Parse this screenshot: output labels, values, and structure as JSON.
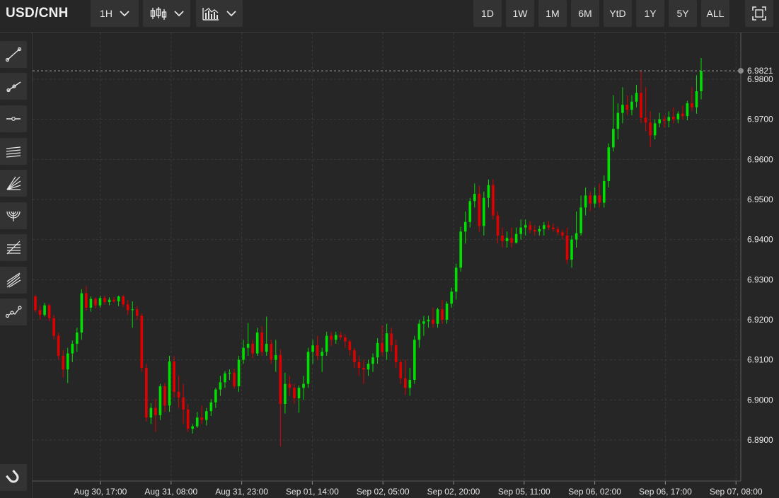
{
  "header": {
    "symbol": "USD/CNH",
    "interval_label": "1H",
    "chart_type_icon": "candlestick-icon",
    "indicators_icon": "indicators-icon",
    "ranges": [
      "1D",
      "1W",
      "1M",
      "6M",
      "YtD",
      "1Y",
      "5Y",
      "ALL"
    ],
    "fullscreen_icon": "fullscreen-icon"
  },
  "sidebar": {
    "tools": [
      "trend-line-icon",
      "ray-icon",
      "horizontal-line-icon",
      "parallel-channel-icon",
      "fib-fan-icon",
      "fib-arc-icon",
      "fib-retracement-icon",
      "pitchfork-icon",
      "path-icon"
    ],
    "bottom_tool": "magnet-icon"
  },
  "colors": {
    "up": "#00e000",
    "down": "#e00000",
    "grid": "#3a3a3a",
    "background": "#262626"
  },
  "chart_data": {
    "type": "candlestick",
    "interval": "1H",
    "ylim": [
      6.881,
      6.988
    ],
    "yticks": [
      "6.8900",
      "6.9000",
      "6.9100",
      "6.9200",
      "6.9300",
      "6.9400",
      "6.9500",
      "6.9600",
      "6.9700",
      "6.9800"
    ],
    "last_price": "6.9821",
    "x_tick_labels": [
      "Aug 30, 17:00",
      "Aug 31, 08:00",
      "Aug 31, 23:00",
      "Sep 01, 14:00",
      "Sep 02, 05:00",
      "Sep 02, 20:00",
      "Sep 05, 11:00",
      "Sep 06, 02:00",
      "Sep 06, 17:00",
      "Sep 07, 08:00"
    ],
    "grid": true,
    "candles": [
      [
        6.9258,
        6.9262,
        6.9218,
        6.9224
      ],
      [
        6.9224,
        6.9236,
        6.92,
        6.9212
      ],
      [
        6.9212,
        6.9242,
        6.9208,
        6.9236
      ],
      [
        6.9236,
        6.924,
        6.9196,
        6.9204
      ],
      [
        6.9204,
        6.9212,
        6.915,
        6.916
      ],
      [
        6.916,
        6.9168,
        6.91,
        6.911
      ],
      [
        6.911,
        6.9124,
        6.9056,
        6.9076
      ],
      [
        6.9076,
        6.913,
        6.9042,
        6.9116
      ],
      [
        6.9116,
        6.9148,
        6.9094,
        6.914
      ],
      [
        6.914,
        6.918,
        6.912,
        6.9168
      ],
      [
        6.9168,
        6.9276,
        6.915,
        6.9266
      ],
      [
        6.9266,
        6.9284,
        6.9222,
        6.923
      ],
      [
        6.923,
        6.9258,
        6.922,
        6.9252
      ],
      [
        6.9252,
        6.9256,
        6.9228,
        6.9236
      ],
      [
        6.9236,
        6.926,
        6.923,
        6.9254
      ],
      [
        6.9254,
        6.926,
        6.9238,
        6.9244
      ],
      [
        6.9244,
        6.9256,
        6.9236,
        6.925
      ],
      [
        6.925,
        6.9256,
        6.9242,
        6.9246
      ],
      [
        6.9246,
        6.926,
        6.9234,
        6.9258
      ],
      [
        6.9258,
        6.9262,
        6.9232,
        6.9238
      ],
      [
        6.9238,
        6.925,
        6.9212,
        6.9224
      ],
      [
        6.9224,
        6.9246,
        6.918,
        6.9226
      ],
      [
        6.9226,
        6.9234,
        6.92,
        6.921
      ],
      [
        6.921,
        6.9216,
        6.907,
        6.908
      ],
      [
        6.908,
        6.909,
        6.8946,
        6.8956
      ],
      [
        6.8956,
        6.8992,
        6.894,
        6.898
      ],
      [
        6.898,
        6.9002,
        6.892,
        6.8962
      ],
      [
        6.8962,
        6.904,
        6.895,
        6.9034
      ],
      [
        6.9034,
        6.9042,
        6.897,
        6.8986
      ],
      [
        6.8986,
        6.911,
        6.897,
        6.9096
      ],
      [
        6.9096,
        6.911,
        6.9006,
        6.902
      ],
      [
        6.902,
        6.906,
        6.898,
        6.9006
      ],
      [
        6.9006,
        6.904,
        6.894,
        6.8976
      ],
      [
        6.8976,
        6.899,
        6.892,
        6.8928
      ],
      [
        6.8928,
        6.894,
        6.8916,
        6.8934
      ],
      [
        6.8934,
        6.897,
        6.893,
        6.8956
      ],
      [
        6.8956,
        6.8986,
        6.894,
        6.895
      ],
      [
        6.895,
        6.898,
        6.8936,
        6.8972
      ],
      [
        6.8972,
        6.9002,
        6.896,
        6.8994
      ],
      [
        6.8994,
        6.903,
        6.898,
        6.9026
      ],
      [
        6.9026,
        6.906,
        6.901,
        6.9044
      ],
      [
        6.9044,
        6.9072,
        6.903,
        6.9066
      ],
      [
        6.9066,
        6.9076,
        6.905,
        6.9068
      ],
      [
        6.9068,
        6.9078,
        6.9028,
        6.9034
      ],
      [
        6.9034,
        6.911,
        6.902,
        6.91
      ],
      [
        6.91,
        6.915,
        6.909,
        6.913
      ],
      [
        6.913,
        6.9192,
        6.911,
        6.914
      ],
      [
        6.914,
        6.915,
        6.9104,
        6.9116
      ],
      [
        6.9116,
        6.918,
        6.911,
        6.9168
      ],
      [
        6.9168,
        6.9184,
        6.911,
        6.912
      ],
      [
        6.912,
        6.9208,
        6.911,
        6.914
      ],
      [
        6.914,
        6.915,
        6.909,
        6.91
      ],
      [
        6.91,
        6.915,
        6.907,
        6.9112
      ],
      [
        6.9112,
        6.9126,
        6.8884,
        6.899
      ],
      [
        6.899,
        6.9068,
        6.8966,
        6.904
      ],
      [
        6.904,
        6.906,
        6.901,
        6.903
      ],
      [
        6.903,
        6.904,
        6.899,
        6.9004
      ],
      [
        6.9004,
        6.9036,
        6.8968,
        6.903
      ],
      [
        6.903,
        6.906,
        6.9,
        6.904
      ],
      [
        6.904,
        6.913,
        6.903,
        6.912
      ],
      [
        6.912,
        6.915,
        6.909,
        6.9136
      ],
      [
        6.9136,
        6.916,
        6.91,
        6.911
      ],
      [
        6.911,
        6.913,
        6.907,
        6.912
      ],
      [
        6.912,
        6.917,
        6.911,
        6.916
      ],
      [
        6.916,
        6.917,
        6.9134,
        6.915
      ],
      [
        6.915,
        6.917,
        6.914,
        6.9162
      ],
      [
        6.9162,
        6.917,
        6.915,
        6.9156
      ],
      [
        6.9156,
        6.9164,
        6.913,
        6.9146
      ],
      [
        6.9146,
        6.915,
        6.911,
        6.9124
      ],
      [
        6.9124,
        6.913,
        6.908,
        6.9094
      ],
      [
        6.9094,
        6.911,
        6.906,
        6.908
      ],
      [
        6.908,
        6.91,
        6.904,
        6.9076
      ],
      [
        6.9076,
        6.91,
        6.906,
        6.909
      ],
      [
        6.909,
        6.9116,
        6.907,
        6.9106
      ],
      [
        6.9106,
        6.9154,
        6.909,
        6.9142
      ],
      [
        6.9142,
        6.9186,
        6.911,
        6.912
      ],
      [
        6.912,
        6.919,
        6.91,
        6.9166
      ],
      [
        6.9166,
        6.918,
        6.912,
        6.9136
      ],
      [
        6.9136,
        6.915,
        6.908,
        6.9094
      ],
      [
        6.9094,
        6.91,
        6.904,
        6.9054
      ],
      [
        6.9054,
        6.91,
        6.9012,
        6.903
      ],
      [
        6.903,
        6.908,
        6.901,
        6.905
      ],
      [
        6.905,
        6.916,
        6.904,
        6.915
      ],
      [
        6.915,
        6.92,
        6.913,
        6.919
      ],
      [
        6.919,
        6.921,
        6.916,
        6.9196
      ],
      [
        6.9196,
        6.921,
        6.918,
        6.92
      ],
      [
        6.92,
        6.923,
        6.918,
        6.919
      ],
      [
        6.919,
        6.923,
        6.918,
        6.9226
      ],
      [
        6.9226,
        6.925,
        6.919,
        6.92
      ],
      [
        6.92,
        6.9246,
        6.919,
        6.924
      ],
      [
        6.924,
        6.928,
        6.923,
        6.927
      ],
      [
        6.927,
        6.934,
        6.925,
        6.933
      ],
      [
        6.933,
        6.9432,
        6.932,
        6.942
      ],
      [
        6.942,
        6.947,
        6.939,
        6.9444
      ],
      [
        6.9444,
        6.9504,
        6.943,
        6.9496
      ],
      [
        6.9496,
        6.954,
        6.948,
        6.9514
      ],
      [
        6.9514,
        6.9534,
        6.942,
        6.9434
      ],
      [
        6.9434,
        6.952,
        6.941,
        6.9504
      ],
      [
        6.9504,
        6.955,
        6.948,
        6.9536
      ],
      [
        6.9536,
        6.955,
        6.945,
        6.946
      ],
      [
        6.946,
        6.947,
        6.939,
        6.941
      ],
      [
        6.941,
        6.943,
        6.938,
        6.9396
      ],
      [
        6.9396,
        6.942,
        6.938,
        6.9404
      ],
      [
        6.9404,
        6.943,
        6.938,
        6.9392
      ],
      [
        6.9392,
        6.943,
        6.939,
        6.9414
      ],
      [
        6.9414,
        6.945,
        6.94,
        6.943
      ],
      [
        6.943,
        6.945,
        6.941,
        6.9436
      ],
      [
        6.9436,
        6.9446,
        6.9416,
        6.9424
      ],
      [
        6.9424,
        6.9436,
        6.941,
        6.942
      ],
      [
        6.942,
        6.9434,
        6.941,
        6.9426
      ],
      [
        6.9426,
        6.9444,
        6.941,
        6.9436
      ],
      [
        6.9436,
        6.9446,
        6.9424,
        6.943
      ],
      [
        6.943,
        6.944,
        6.942,
        6.9426
      ],
      [
        6.9426,
        6.9432,
        6.941,
        6.9418
      ],
      [
        6.9418,
        6.9424,
        6.94,
        6.941
      ],
      [
        6.941,
        6.943,
        6.934,
        6.935
      ],
      [
        6.935,
        6.941,
        6.933,
        6.94
      ],
      [
        6.94,
        6.947,
        6.938,
        6.9416
      ],
      [
        6.9416,
        6.951,
        6.941,
        6.948
      ],
      [
        6.948,
        6.953,
        6.946,
        6.951
      ],
      [
        6.951,
        6.952,
        6.947,
        6.949
      ],
      [
        6.949,
        6.953,
        6.948,
        6.951
      ],
      [
        6.951,
        6.954,
        6.948,
        6.9492
      ],
      [
        6.9492,
        6.956,
        6.948,
        6.9546
      ],
      [
        6.9546,
        6.964,
        6.953,
        6.963
      ],
      [
        6.963,
        6.976,
        6.962,
        6.9676
      ],
      [
        6.9676,
        6.974,
        6.965,
        6.9716
      ],
      [
        6.9716,
        6.978,
        6.969,
        6.9736
      ],
      [
        6.9736,
        6.976,
        6.971,
        6.9724
      ],
      [
        6.9724,
        6.976,
        6.971,
        6.9744
      ],
      [
        6.9744,
        6.9786,
        6.973,
        6.9766
      ],
      [
        6.9766,
        6.9821,
        6.969,
        6.9704
      ],
      [
        6.9704,
        6.978,
        6.967,
        6.9692
      ],
      [
        6.9692,
        6.972,
        6.963,
        6.966
      ],
      [
        6.966,
        6.97,
        6.965,
        6.969
      ],
      [
        6.969,
        6.9716,
        6.968,
        6.97
      ],
      [
        6.97,
        6.971,
        6.968,
        6.9696
      ],
      [
        6.9696,
        6.972,
        6.968,
        6.9706
      ],
      [
        6.9706,
        6.973,
        6.969,
        6.97
      ],
      [
        6.97,
        6.972,
        6.969,
        6.9714
      ],
      [
        6.9714,
        6.9734,
        6.97,
        6.9708
      ],
      [
        6.9708,
        6.9746,
        6.9698,
        6.974
      ],
      [
        6.974,
        6.978,
        6.972,
        6.973
      ],
      [
        6.973,
        6.981,
        6.9714,
        6.977
      ],
      [
        6.977,
        6.9853,
        6.975,
        6.9821
      ]
    ]
  }
}
